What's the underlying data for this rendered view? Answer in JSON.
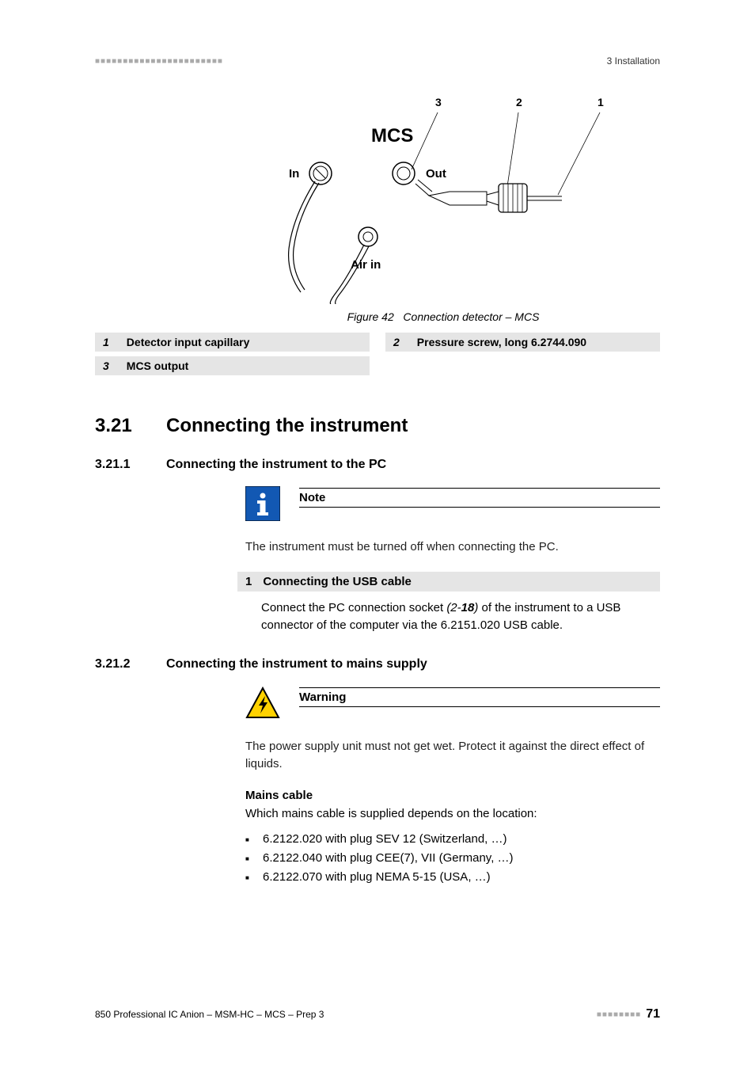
{
  "header": {
    "right_text": "3 Installation"
  },
  "figure": {
    "title_top": "MCS",
    "label_in": "In",
    "label_out": "Out",
    "label_airin": "Air in",
    "callout_1": "1",
    "callout_2": "2",
    "callout_3": "3",
    "caption_prefix": "Figure 42",
    "caption_text": "Connection detector – MCS"
  },
  "legend": {
    "items": [
      {
        "num": "1",
        "text": "Detector input capillary"
      },
      {
        "num": "2",
        "text": "Pressure screw, long 6.2744.090"
      },
      {
        "num": "3",
        "text": "MCS output"
      }
    ]
  },
  "section": {
    "num": "3.21",
    "title": "Connecting the instrument"
  },
  "sub1": {
    "num": "3.21.1",
    "title": "Connecting the instrument to the PC",
    "note_label": "Note",
    "note_body": "The instrument must be turned off when connecting the PC.",
    "step_num": "1",
    "step_title": "Connecting the USB cable",
    "step_body_a": "Connect the PC connection socket ",
    "step_ref_a": "(2-",
    "step_ref_b": "18",
    "step_ref_c": ")",
    "step_body_b": " of the instrument to a USB connector of the computer via the 6.2151.020 USB cable."
  },
  "sub2": {
    "num": "3.21.2",
    "title": "Connecting the instrument to mains supply",
    "warn_label": "Warning",
    "warn_body": "The power supply unit must not get wet. Protect it against the direct effect of liquids.",
    "mains_title": "Mains cable",
    "mains_intro": "Which mains cable is supplied depends on the location:",
    "mains_items": [
      "6.2122.020 with plug SEV 12 (Switzerland, …)",
      "6.2122.040 with plug CEE(7), VII (Germany, …)",
      "6.2122.070 with plug NEMA 5-15 (USA, …)"
    ]
  },
  "footer": {
    "left": "850 Professional IC Anion – MSM-HC – MCS – Prep 3",
    "page": "71"
  }
}
